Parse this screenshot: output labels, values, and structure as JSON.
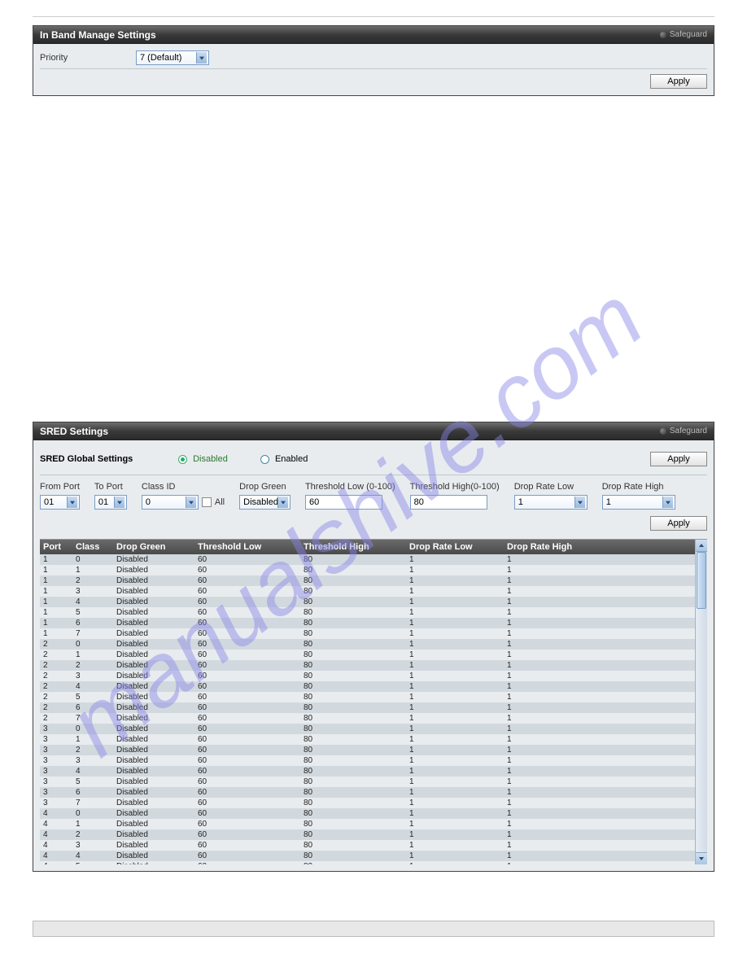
{
  "panel1": {
    "title": "In Band Manage Settings",
    "safeguard": "Safeguard",
    "priority_label": "Priority",
    "priority_value": "7 (Default)",
    "apply": "Apply"
  },
  "panel2": {
    "title": "SRED Settings",
    "safeguard": "Safeguard",
    "global_label": "SRED Global Settings",
    "radio_disabled": "Disabled",
    "radio_enabled": "Enabled",
    "apply": "Apply",
    "form": {
      "from_port": "From Port",
      "from_port_val": "01",
      "to_port": "To Port",
      "to_port_val": "01",
      "class_id": "Class ID",
      "class_id_val": "0",
      "all": "All",
      "drop_green": "Drop Green",
      "drop_green_val": "Disabled",
      "thr_low": "Threshold Low (0-100)",
      "thr_low_val": "60",
      "thr_high": "Threshold High(0-100)",
      "thr_high_val": "80",
      "drl": "Drop Rate Low",
      "drl_val": "1",
      "drh": "Drop Rate High",
      "drh_val": "1"
    },
    "headers": {
      "port": "Port",
      "class": "Class",
      "drop_green": "Drop Green",
      "thr_low": "Threshold Low",
      "thr_high": "Threshold High",
      "drl": "Drop Rate Low",
      "drh": "Drop Rate High"
    },
    "row_defaults": {
      "dg": "Disabled",
      "tl": "60",
      "th": "80",
      "drl": "1",
      "drh": "1"
    },
    "visible_ports": [
      1,
      2,
      3,
      4
    ],
    "classes_per_port": 8
  },
  "watermark": "manualshive.com"
}
